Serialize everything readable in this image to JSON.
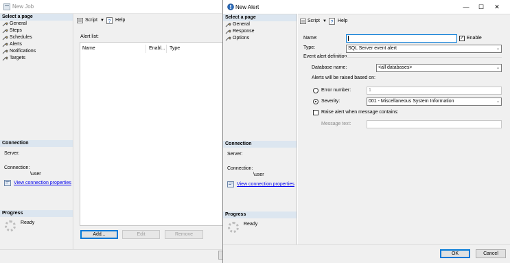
{
  "job_window": {
    "title": "New Job",
    "select_page_header": "Select a page",
    "pages": [
      {
        "label": "General"
      },
      {
        "label": "Steps"
      },
      {
        "label": "Schedules"
      },
      {
        "label": "Alerts"
      },
      {
        "label": "Notifications"
      },
      {
        "label": "Targets"
      }
    ],
    "toolbar": {
      "script_label": "Script",
      "help_label": "Help"
    },
    "alert_list_label": "Alert list:",
    "columns": [
      "Name",
      "Enabl...",
      "Type"
    ],
    "buttons": {
      "add": "Add...",
      "edit": "Edit",
      "remove": "Remove"
    },
    "connection": {
      "header": "Connection",
      "server_label": "Server:",
      "connection_label": "Connection:",
      "user": "\\user",
      "view_props": "View connection properties"
    },
    "progress": {
      "header": "Progress",
      "status": "Ready"
    }
  },
  "alert_window": {
    "title": "New Alert",
    "controls": {
      "minimize": "—",
      "maximize": "☐",
      "close": "✕"
    },
    "select_page_header": "Select a page",
    "pages": [
      {
        "label": "General"
      },
      {
        "label": "Response"
      },
      {
        "label": "Options"
      }
    ],
    "toolbar": {
      "script_label": "Script",
      "help_label": "Help"
    },
    "form": {
      "name_label": "Name:",
      "name_value": "",
      "enable_label": "Enable",
      "type_label": "Type:",
      "type_value": "SQL Server event alert",
      "event_def_label": "Event alert definition",
      "db_label": "Database name:",
      "db_value": "<all databases>",
      "raised_label": "Alerts will be raised based on:",
      "error_number_label": "Error number:",
      "error_number_value": "1",
      "severity_label": "Severity:",
      "severity_value": "001 - Miscellaneous System Information",
      "raise_when_label": "Raise alert when message contains:",
      "message_text_label": "Message text:"
    },
    "connection": {
      "header": "Connection",
      "server_label": "Server:",
      "connection_label": "Connection:",
      "user": "\\user",
      "view_props": "View connection properties"
    },
    "progress": {
      "header": "Progress",
      "status": "Ready"
    },
    "buttons": {
      "ok": "OK",
      "cancel": "Cancel"
    }
  }
}
